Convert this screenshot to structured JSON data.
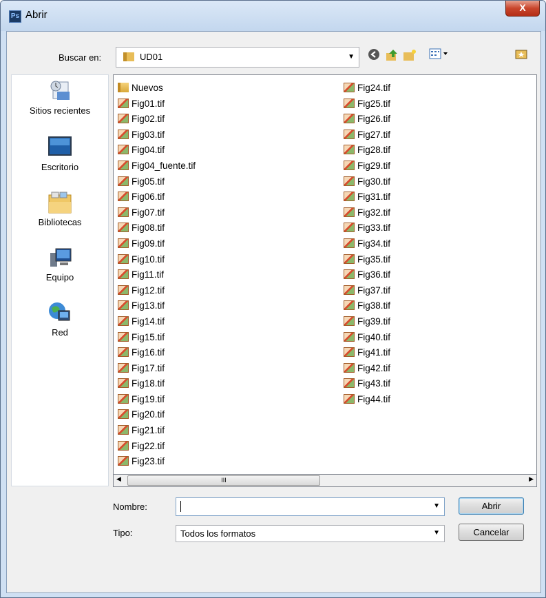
{
  "window": {
    "title": "Abrir",
    "app_icon": "Ps",
    "close_label": "X"
  },
  "lookin": {
    "label": "Buscar en:",
    "value": "UD01"
  },
  "toolbar": [
    "back-icon",
    "up-folder-icon",
    "new-folder-icon",
    "view-menu-icon"
  ],
  "places": [
    {
      "label": "Sitios recientes",
      "icon": "recent-places-icon"
    },
    {
      "label": "Escritorio",
      "icon": "desktop-icon"
    },
    {
      "label": "Bibliotecas",
      "icon": "libraries-icon"
    },
    {
      "label": "Equipo",
      "icon": "computer-icon"
    },
    {
      "label": "Red",
      "icon": "network-icon"
    }
  ],
  "files": {
    "column1": [
      "Nuevos",
      "Fig01.tif",
      "Fig02.tif",
      "Fig03.tif",
      "Fig04.tif",
      "Fig04_fuente.tif",
      "Fig05.tif",
      "Fig06.tif",
      "Fig07.tif",
      "Fig08.tif",
      "Fig09.tif",
      "Fig10.tif",
      "Fig11.tif",
      "Fig12.tif",
      "Fig13.tif",
      "Fig14.tif",
      "Fig15.tif",
      "Fig16.tif",
      "Fig17.tif",
      "Fig18.tif",
      "Fig19.tif",
      "Fig20.tif",
      "Fig21.tif",
      "Fig22.tif",
      "Fig23.tif"
    ],
    "column2": [
      "Fig24.tif",
      "Fig25.tif",
      "Fig26.tif",
      "Fig27.tif",
      "Fig28.tif",
      "Fig29.tif",
      "Fig30.tif",
      "Fig31.tif",
      "Fig32.tif",
      "Fig33.tif",
      "Fig34.tif",
      "Fig35.tif",
      "Fig36.tif",
      "Fig37.tif",
      "Fig38.tif",
      "Fig39.tif",
      "Fig40.tif",
      "Fig41.tif",
      "Fig42.tif",
      "Fig43.tif",
      "Fig44.tif"
    ]
  },
  "scroll": {
    "thumb_grip": "III"
  },
  "form": {
    "name_label": "Nombre:",
    "name_value": "",
    "type_label": "Tipo:",
    "type_value": "Todos los formatos"
  },
  "buttons": {
    "open": "Abrir",
    "cancel": "Cancelar"
  },
  "colors": {
    "title_bg": "#c3d7ee",
    "close_red": "#c9452c",
    "client_bg": "#f0f0f0"
  }
}
